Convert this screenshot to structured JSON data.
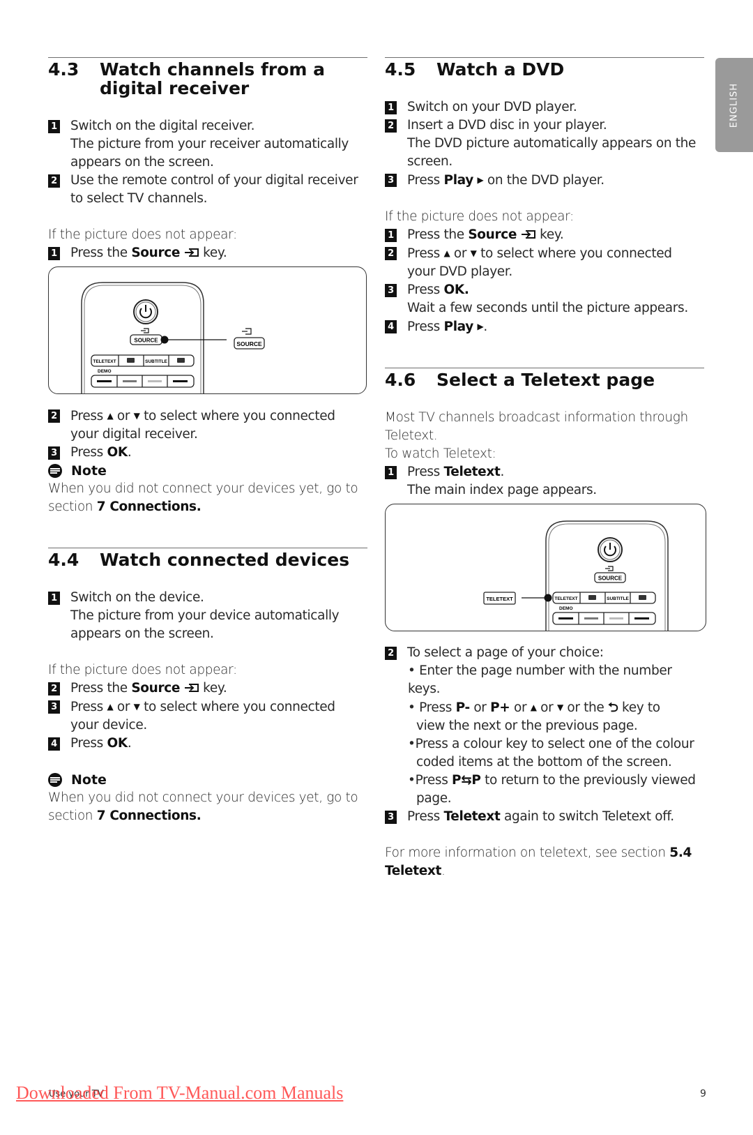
{
  "side_tab": {
    "label": "ENGLISH",
    "color": "#9a9a9a"
  },
  "sections": {
    "s43": {
      "number": "4.3",
      "title_line1": "Watch channels from a",
      "title_line2": "digital receiver",
      "step1": "Switch on the digital receiver.",
      "step1_detail1": "The picture from your receiver automatically",
      "step1_detail2": "appears on the screen.",
      "step2_line1": "Use the remote control of your digital receiver",
      "step2_line2": "to select TV channels.",
      "if_not": "If the picture does not appear:",
      "fix1_pre": "Press the ",
      "fix1_key": "Source",
      "fix1_post": " key.",
      "fix2_pre": "Press ",
      "fix2_mid": " or ",
      "fix2_post": " to select where you connected",
      "fix2_line2": "your digital receiver.",
      "fix3_pre": "Press ",
      "fix3_key": "OK",
      "fix3_post": ".",
      "note_title": "Note",
      "note_line1": "When you did not connect your devices yet, go to",
      "note_line2_pre": "section ",
      "note_line2_link": "7 Connections."
    },
    "s44": {
      "number": "4.4",
      "title": "Watch connected devices",
      "step1": "Switch on the device.",
      "step1_detail1": "The picture from your device automatically",
      "step1_detail2": "appears on the screen.",
      "if_not": "If the picture does not appear:",
      "fix2_pre": "Press the ",
      "fix2_key": "Source",
      "fix2_post": " key.",
      "fix3_pre": "Press ",
      "fix3_mid": " or ",
      "fix3_post": " to select where you connected",
      "fix3_line2": "your device.",
      "fix4_pre": "Press ",
      "fix4_key": "OK",
      "fix4_post": ".",
      "note_title": "Note",
      "note_line1": "When you did not connect your devices yet, go to",
      "note_line2_pre": "section ",
      "note_line2_link": "7 Connections."
    },
    "s45": {
      "number": "4.5",
      "title": "Watch a DVD",
      "step1": "Switch on your DVD player.",
      "step2": "Insert a DVD disc in your player.",
      "step2_detail1": "The DVD picture automatically appears on the",
      "step2_detail2": "screen.",
      "step3_pre": "Press ",
      "step3_key": "Play",
      "step3_post": " on the DVD player.",
      "if_not": "If the picture does not appear:",
      "fix1_pre": "Press the ",
      "fix1_key": "Source",
      "fix1_post": " key.",
      "fix2_pre": "Press ",
      "fix2_mid": " or ",
      "fix2_post": " to select where you connected",
      "fix2_line2": "your DVD player.",
      "fix3_pre": "Press ",
      "fix3_key": "OK.",
      "fix3_detail": "Wait a few seconds until the picture appears.",
      "fix4_pre": "Press ",
      "fix4_key": "Play",
      "fix4_post": "."
    },
    "s46": {
      "number": "4.6",
      "title": "Select a Teletext page",
      "intro1": "Most TV channels broadcast information through",
      "intro2": "Teletext.",
      "intro3": "To watch Teletext:",
      "step1_pre": "Press ",
      "step1_key": "Teletext",
      "step1_post": ".",
      "step1_detail": "The main index page appears.",
      "step2": "To select a page of your choice:",
      "bullet1": "Enter the page number with the number keys.",
      "bullet2_a": "Press ",
      "bullet2_pminus": "P-",
      "bullet2_b": " or ",
      "bullet2_pplus": "P+",
      "bullet2_c": " or ",
      "bullet2_d": " or ",
      "bullet2_e": " or the ",
      "bullet2_f": " key  to",
      "bullet2_line2": "view the next or the previous page.",
      "bullet3_line1": "Press a colour key to select one of the colour",
      "bullet3_line2": "coded items at the bottom of the screen.",
      "bullet4_pre": "Press ",
      "bullet4_key": "P⇆P",
      "bullet4_post": " to return to the previously viewed",
      "bullet4_line2": "page.",
      "step3_pre": "Press ",
      "step3_key": "Teletext",
      "step3_post": " again to switch Teletext off.",
      "more_pre": "For more information on teletext, see section ",
      "more_link1": "5.4",
      "more_link2": "Teletext",
      "more_post": "."
    }
  },
  "step_numbers": [
    "1",
    "2",
    "3",
    "4"
  ],
  "glyphs": {
    "up": "▲",
    "down": "▼",
    "play": "▶",
    "bullet": "•",
    "back": "⮌"
  },
  "remote": {
    "source_label": "SOURCE",
    "teletext_label": "TELETEXT",
    "subtitle_label": "SUBTITLE",
    "demo_label": "DEMO",
    "callout_source": "SOURCE",
    "callout_teletext": "TELETEXT"
  },
  "footer": {
    "chapter": "Use your TV",
    "page_number": "9",
    "watermark": "Downloaded From TV-Manual.com Manuals",
    "watermark_color": "#ff3b3b"
  }
}
